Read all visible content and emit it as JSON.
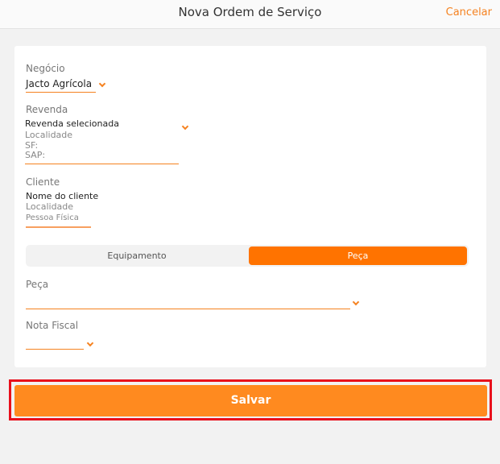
{
  "header": {
    "title": "Nova Ordem de Serviço",
    "cancel_label": "Cancelar"
  },
  "form": {
    "negocio": {
      "label": "Negócio",
      "value": "Jacto Agrícola"
    },
    "revenda": {
      "label": "Revenda",
      "value": "Revenda selecionada",
      "localidade": "Localidade",
      "sf": "SF:",
      "sap": "SAP:"
    },
    "cliente": {
      "label": "Cliente",
      "value": "Nome do cliente",
      "localidade": "Localidade",
      "tipo": "Pessoa Física"
    },
    "segment": {
      "options": [
        "Equipamento",
        "Peça"
      ],
      "selected": "Peça"
    },
    "peca": {
      "label": "Peça",
      "value": ""
    },
    "nota_fiscal": {
      "label": "Nota Fiscal",
      "value": ""
    }
  },
  "footer": {
    "save_label": "Salvar"
  },
  "colors": {
    "accent": "#ff7300",
    "highlight": "#e8101c"
  }
}
